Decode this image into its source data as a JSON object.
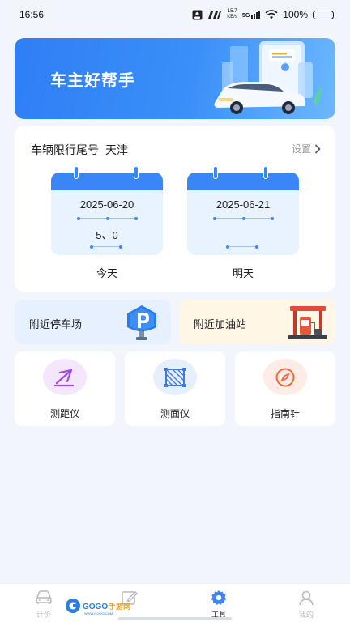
{
  "status_bar": {
    "time": "16:56",
    "network_speed_value": "15.7",
    "network_speed_unit": "KB/s",
    "signal_label": "5G",
    "battery": "100%",
    "colors": {
      "battery_fill": "#6ecc3e"
    }
  },
  "banner": {
    "title": "车主好帮手",
    "colors": {
      "gradient_start": "#2f7ff5",
      "gradient_end": "#6cb7ff"
    }
  },
  "restriction": {
    "title": "车辆限行尾号",
    "city": "天津",
    "settings_label": "设置",
    "days": [
      {
        "date": "2025-06-20",
        "digits": "5、0",
        "label": "今天"
      },
      {
        "date": "2025-06-21",
        "digits": "",
        "label": "明天"
      }
    ],
    "colors": {
      "accent": "#3a86f6",
      "calendar_bg": "#e9f2ff"
    }
  },
  "nearby": {
    "parking": {
      "label": "附近停车场",
      "icon": "parking-sign-icon",
      "bg": "#e6f0ff"
    },
    "gas": {
      "label": "附近加油站",
      "icon": "gas-station-icon",
      "bg": "#fff6e6"
    }
  },
  "tools": [
    {
      "label": "测距仪",
      "icon": "distance-measure-icon",
      "circle_bg": "#f4e6ff",
      "icon_color": "#a24be0"
    },
    {
      "label": "测面仪",
      "icon": "area-measure-icon",
      "circle_bg": "#e6efff",
      "icon_color": "#3b7be8"
    },
    {
      "label": "指南针",
      "icon": "compass-icon",
      "circle_bg": "#ffece6",
      "icon_color": "#f06a3a"
    }
  ],
  "bottom_nav": {
    "items": [
      {
        "label": "计价",
        "icon": "car-icon",
        "active": false
      },
      {
        "label": "",
        "icon": "edit-icon",
        "active": false
      },
      {
        "label": "工具",
        "icon": "tools-gear-icon",
        "active": true
      },
      {
        "label": "我的",
        "icon": "user-icon",
        "active": false
      }
    ],
    "watermark": "GOGO手游网",
    "colors": {
      "active": "#3a86f6",
      "inactive": "#b4b9c2"
    }
  }
}
